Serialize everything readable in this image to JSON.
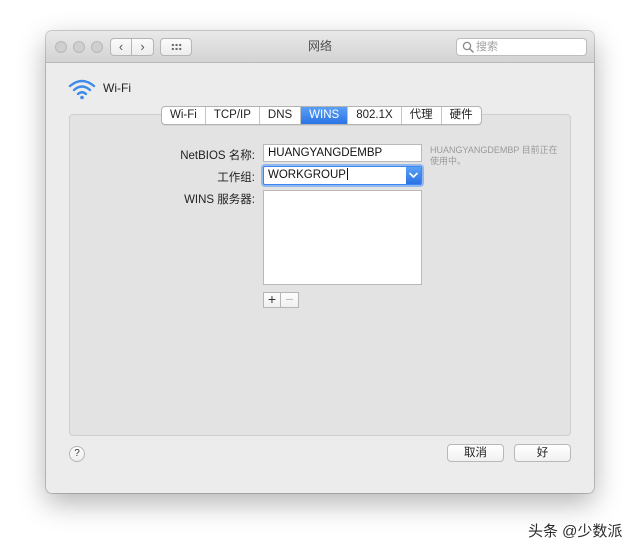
{
  "window": {
    "title": "网络",
    "search": {
      "placeholder": "搜索"
    }
  },
  "interface": {
    "name": "Wi-Fi",
    "icon": "wifi-icon"
  },
  "tabs": [
    {
      "label": "Wi-Fi",
      "active": false
    },
    {
      "label": "TCP/IP",
      "active": false
    },
    {
      "label": "DNS",
      "active": false
    },
    {
      "label": "WINS",
      "active": true
    },
    {
      "label": "802.1X",
      "active": false
    },
    {
      "label": "代理",
      "active": false
    },
    {
      "label": "硬件",
      "active": false
    }
  ],
  "wins": {
    "netbios_label": "NetBIOS 名称:",
    "netbios_value": "HUANGYANGDEMBP",
    "netbios_hint": "HUANGYANGDEMBP 目前正在使用中。",
    "workgroup_label": "工作组:",
    "workgroup_value": "WORKGROUP",
    "servers_label": "WINS 服务器:",
    "servers": [],
    "add_label": "+",
    "remove_label": "−"
  },
  "footer": {
    "help_label": "?",
    "cancel_label": "取消",
    "ok_label": "好"
  },
  "watermark": "头条 @少数派",
  "colors": {
    "accent": "#2a74e6",
    "window_bg": "#ececec",
    "panel_bg": "#e3e3e3"
  }
}
